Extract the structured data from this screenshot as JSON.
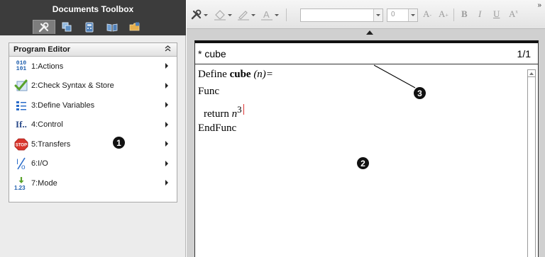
{
  "toolbox": {
    "title": "Documents Toolbox",
    "tabs": [
      {
        "icon": "tools-icon",
        "active": true
      },
      {
        "icon": "page-sorter-icon",
        "active": false
      },
      {
        "icon": "scratchpad-icon",
        "active": false
      },
      {
        "icon": "content-explorer-icon",
        "active": false
      },
      {
        "icon": "utilities-icon",
        "active": false
      }
    ]
  },
  "program_editor": {
    "title": "Program Editor",
    "collapse_glyph": "≈",
    "items": [
      {
        "label": "1:Actions",
        "icon": "actions-icon",
        "icon_text": "010\n101"
      },
      {
        "label": "2:Check Syntax & Store",
        "icon": "check-syntax-icon"
      },
      {
        "label": "3:Define Variables",
        "icon": "define-variables-icon"
      },
      {
        "label": "4:Control",
        "icon": "control-icon",
        "icon_text": "If.."
      },
      {
        "label": "5:Transfers",
        "icon": "transfers-stop-icon",
        "icon_text": "STOP"
      },
      {
        "label": "6:I/O",
        "icon": "io-icon",
        "icon_text": "I/O"
      },
      {
        "label": "7:Mode",
        "icon": "mode-icon",
        "icon_text": "1.23"
      }
    ]
  },
  "toolbar": {
    "font_name": "",
    "font_size": "0",
    "size_down": "A",
    "size_up": "A",
    "bold": "B",
    "italic": "I",
    "underline": "U",
    "superscript": "A",
    "overflow": "»"
  },
  "editor": {
    "program_name": "* cube",
    "page_indicator": "1/1",
    "code": {
      "define_prefix": "Define ",
      "function_name": "cube",
      "params": "(n)=",
      "func_keyword": "Func",
      "return_keyword": "return ",
      "return_var": "n",
      "exponent": "3",
      "endfunc_keyword": "EndFunc"
    }
  },
  "callouts": {
    "one": "1",
    "two": "2",
    "three": "3"
  },
  "colors": {
    "toolbox_header": "#3c3c3c",
    "icon_blue": "#1f5fae",
    "stop_red": "#d9342b",
    "check_green": "#59a22b"
  }
}
